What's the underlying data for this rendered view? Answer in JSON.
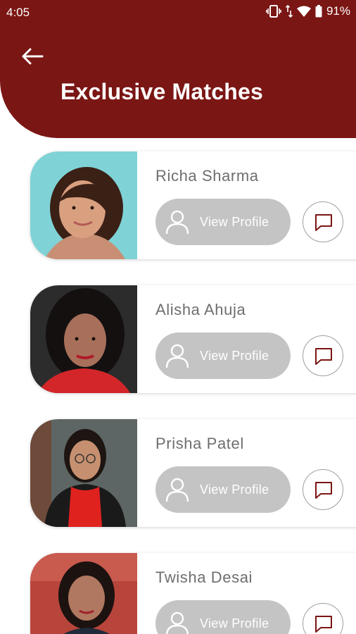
{
  "status_bar": {
    "time": "4:05",
    "battery": "91%"
  },
  "header": {
    "title": "Exclusive Matches"
  },
  "matches": [
    {
      "name": "Richa Sharma",
      "view_label": "View Profile"
    },
    {
      "name": "Alisha Ahuja",
      "view_label": "View Profile"
    },
    {
      "name": "Prisha Patel",
      "view_label": "View Profile"
    },
    {
      "name": "Twisha Desai",
      "view_label": "View Profile"
    }
  ],
  "colors": {
    "header": "#7a1614",
    "button": "#c4c4c4",
    "name_text": "#6e6e6e",
    "chat_icon": "#7a1614"
  }
}
